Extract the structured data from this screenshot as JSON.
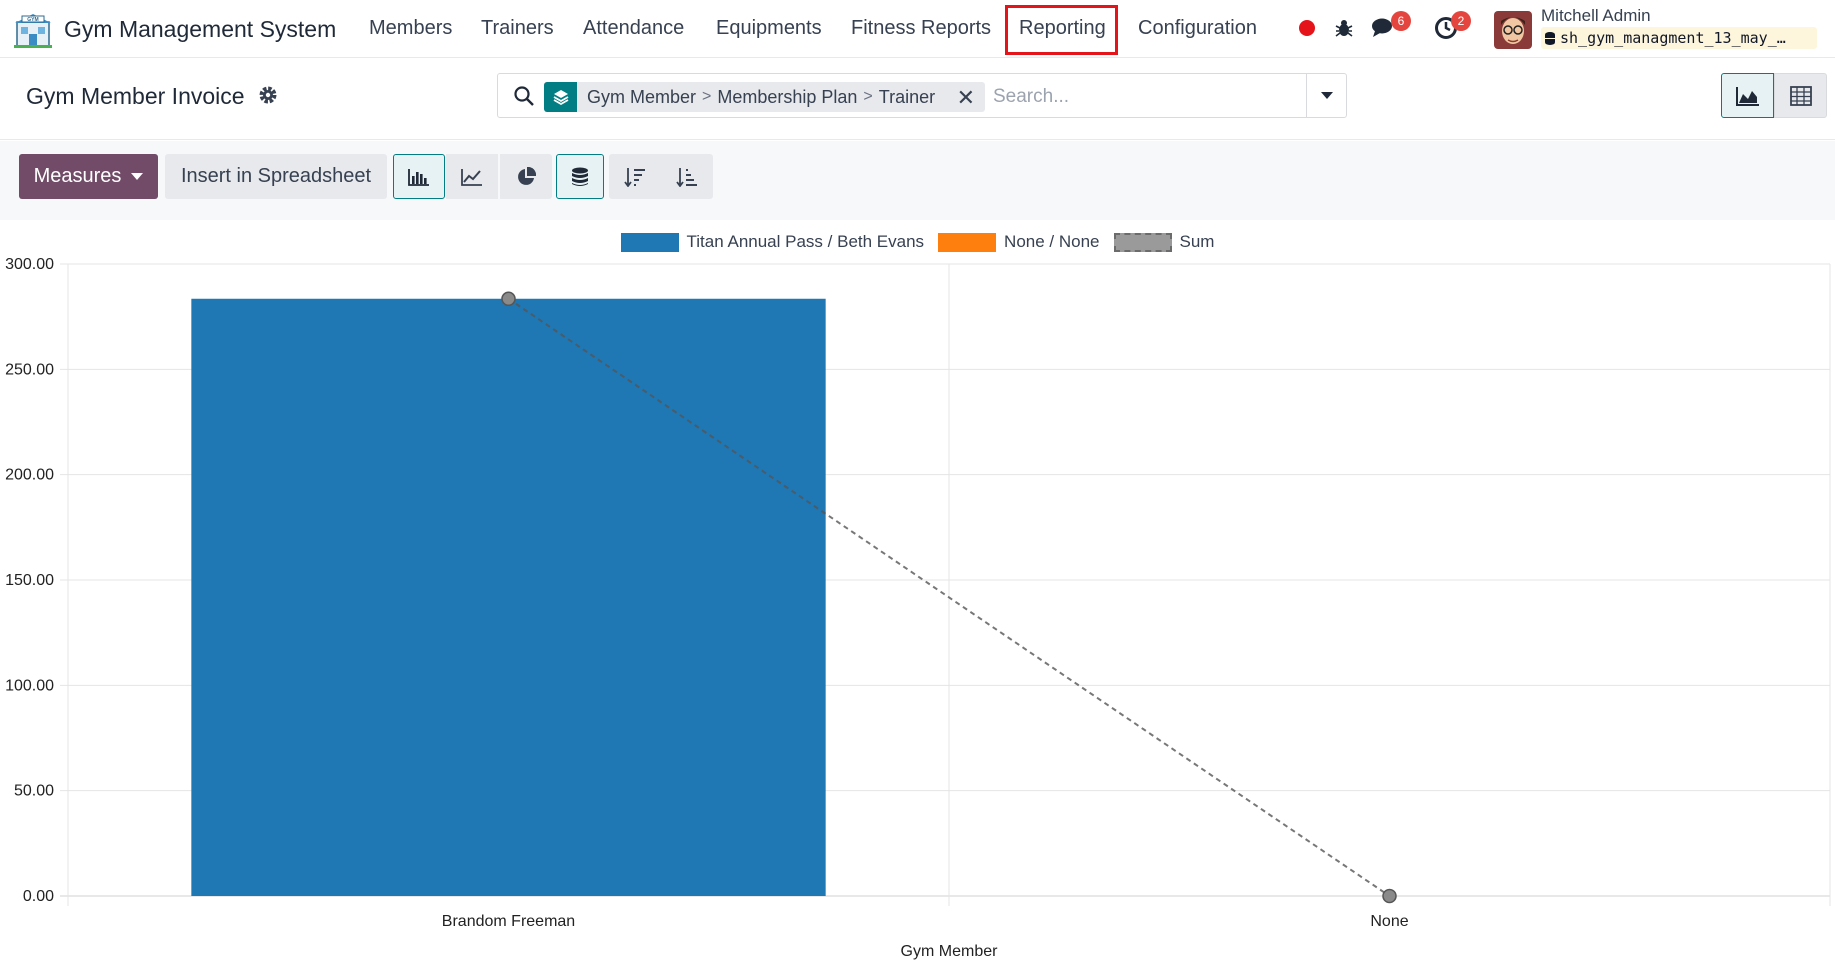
{
  "app": {
    "name": "Gym Management System",
    "icon": "gym-building-icon"
  },
  "nav": {
    "items": [
      "Members",
      "Trainers",
      "Attendance",
      "Equipments",
      "Fitness Reports",
      "Reporting",
      "Configuration"
    ],
    "highlighted": "Reporting"
  },
  "systray": {
    "messages_count": "6",
    "activities_count": "2",
    "user_name": "Mitchell Admin",
    "database": "sh_gym_managment_13_may_…"
  },
  "page": {
    "title": "Gym Member Invoice"
  },
  "search": {
    "facet_group_icon": "layers-icon",
    "facet_parts": [
      "Gym Member",
      "Membership Plan",
      "Trainer"
    ],
    "separator": ">",
    "placeholder": "Search..."
  },
  "toolbar": {
    "measures_label": "Measures",
    "spreadsheet_label": "Insert in Spreadsheet"
  },
  "colors": {
    "brand": "#714b67",
    "accent": "#017e84",
    "series_1": "#1f77b4",
    "series_2": "#ff7f0e",
    "sum": "#888888",
    "highlight_box": "#e5141b"
  },
  "chart_data": {
    "type": "bar",
    "xlabel": "Gym Member",
    "ylabel": "",
    "categories": [
      "Brandom Freeman",
      "None"
    ],
    "series": [
      {
        "name": "Titan Annual Pass / Beth Evans",
        "values": [
          283.5,
          0
        ]
      },
      {
        "name": "None / None",
        "values": [
          0,
          0
        ]
      }
    ],
    "sum_series": {
      "name": "Sum",
      "values": [
        283.5,
        0
      ]
    },
    "ylim": [
      0,
      300
    ],
    "yticks": [
      "0.00",
      "50.00",
      "100.00",
      "150.00",
      "200.00",
      "250.00",
      "300.00"
    ],
    "grid": true,
    "legend_position": "top"
  }
}
